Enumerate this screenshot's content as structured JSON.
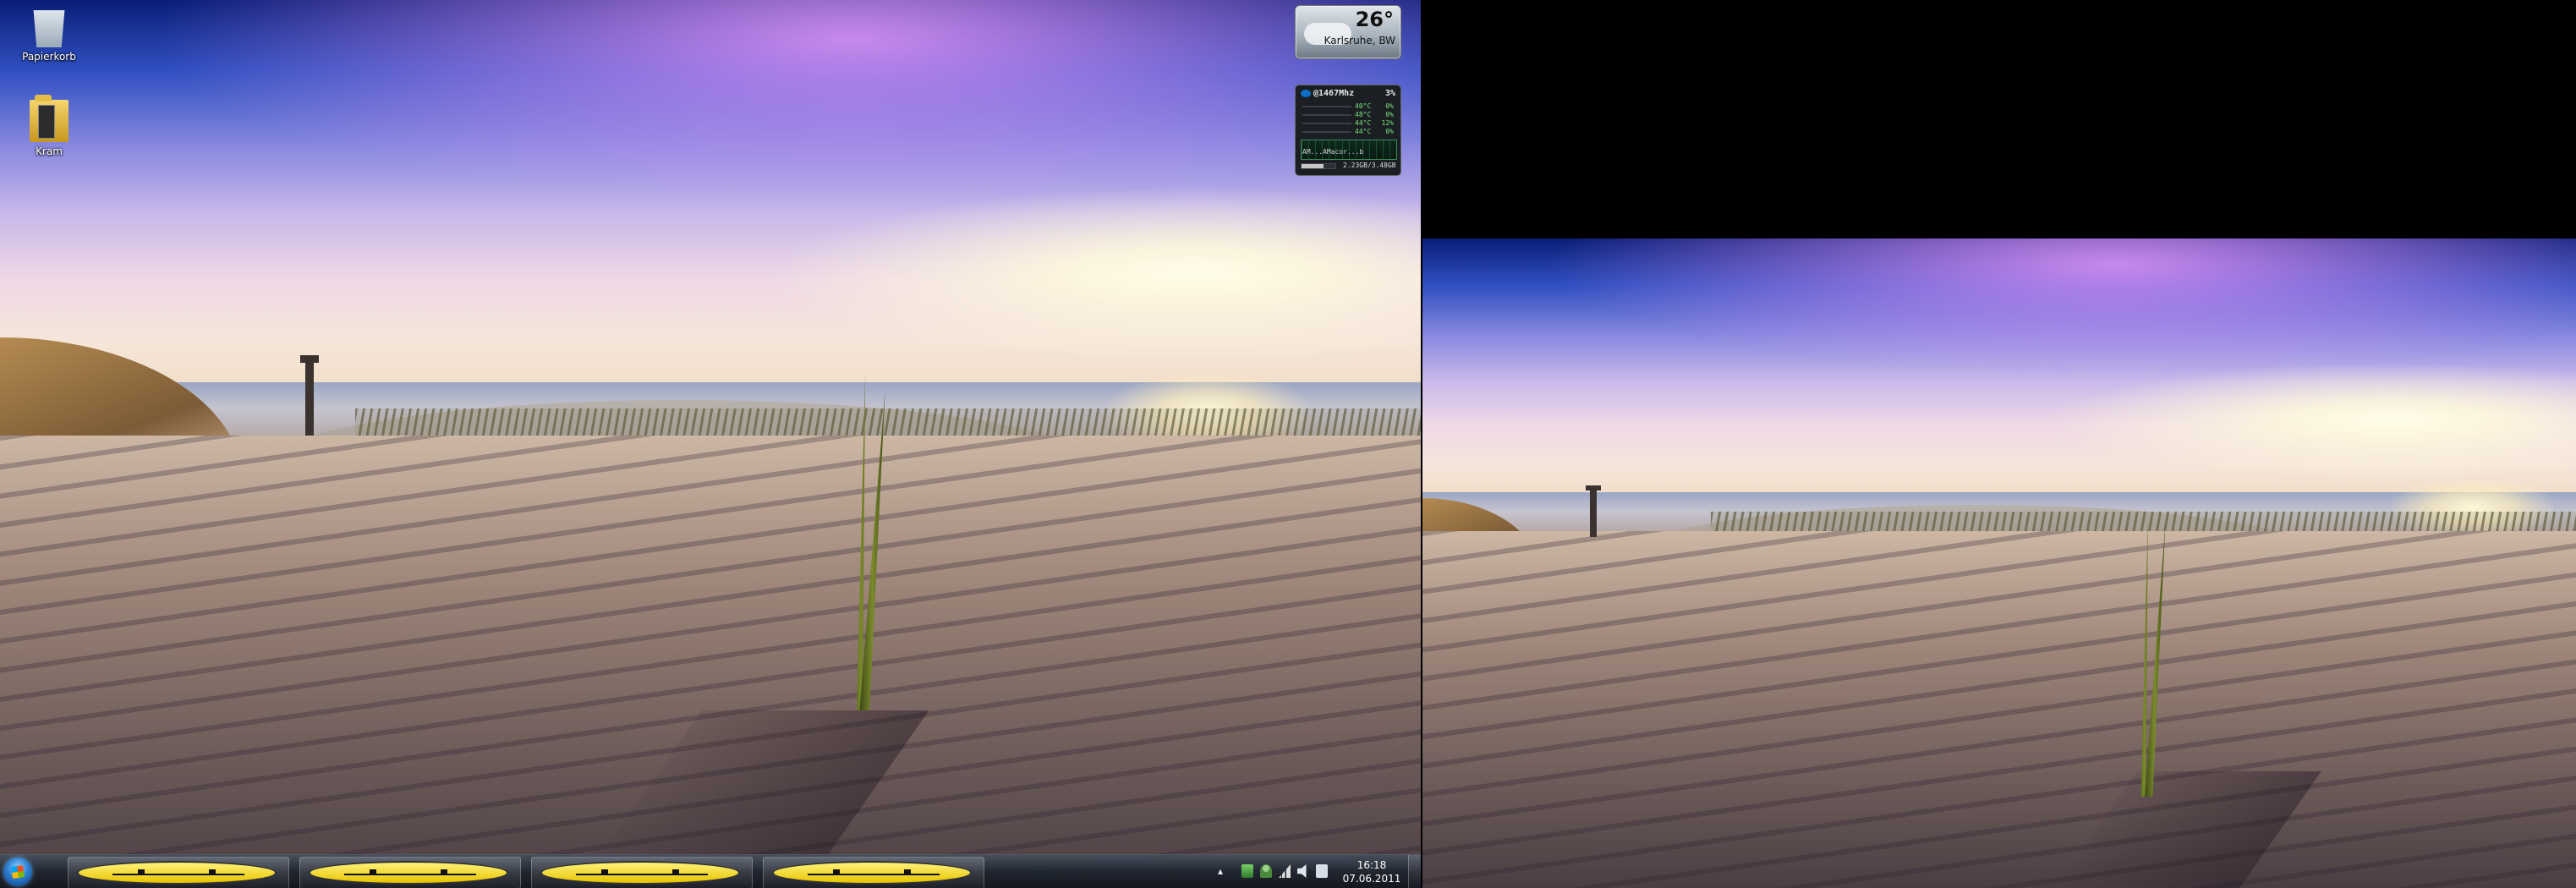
{
  "desktop": {
    "icons": [
      {
        "label": "Papierkorb",
        "icon": "recycle-bin-icon"
      },
      {
        "label": "Kram",
        "icon": "folder-icon"
      }
    ]
  },
  "gadgets": {
    "weather": {
      "temperature": "26°",
      "location": "Karlsruhe, BW"
    },
    "cpu_meter": {
      "frequency": "@1467Mhz",
      "usage": "3%",
      "cores": [
        {
          "temp": "40°C",
          "usage": "0%"
        },
        {
          "temp": "48°C",
          "usage": "0%"
        },
        {
          "temp": "44°C",
          "usage": "12%"
        },
        {
          "temp": "44°C",
          "usage": "0%"
        }
      ],
      "graph_label": "AM...AMacor...b",
      "memory": "2.23GB/3.48GB",
      "memory_fraction": 0.64
    }
  },
  "taskbar": {
    "start_icon": "windows-start-icon",
    "tasks": [
      {
        "icon": "smiley-face-icon"
      },
      {
        "icon": "smiley-face-icon"
      },
      {
        "icon": "smiley-face-icon"
      },
      {
        "icon": "smiley-face-icon"
      }
    ],
    "tray": {
      "chevron": "▴",
      "icons": [
        "network-icon",
        "user-icon",
        "signal-icon",
        "speaker-icon",
        "battery-icon"
      ],
      "time": "16:18",
      "date": "07.06.2011"
    }
  },
  "colors": {
    "taskbar": "#1e2430",
    "sky_top": "#0a1e78",
    "sand": "#9b8377"
  }
}
